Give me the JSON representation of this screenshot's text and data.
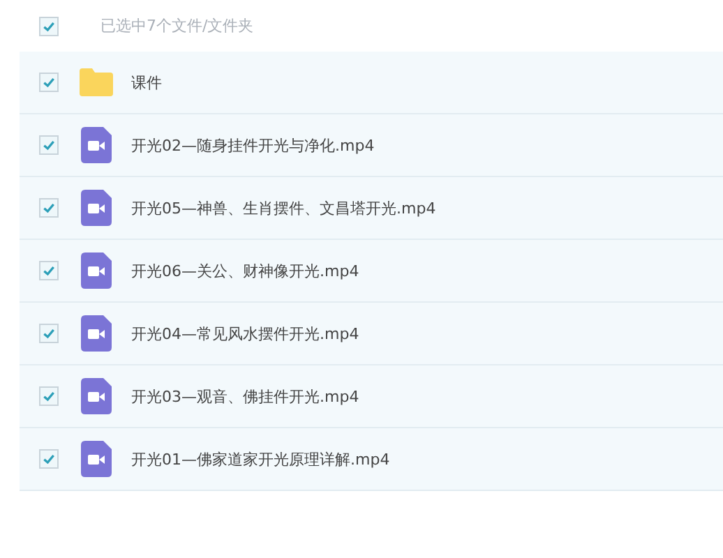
{
  "header": {
    "checked": true,
    "label": "已选中7个文件/文件夹"
  },
  "files": [
    {
      "kind": "folder",
      "name": "课件",
      "checked": true
    },
    {
      "kind": "video",
      "name": "开光02—随身挂件开光与净化.mp4",
      "checked": true
    },
    {
      "kind": "video",
      "name": "开光05—神兽、生肖摆件、文昌塔开光.mp4",
      "checked": true
    },
    {
      "kind": "video",
      "name": "开光06—关公、财神像开光.mp4",
      "checked": true
    },
    {
      "kind": "video",
      "name": "开光04—常见风水摆件开光.mp4",
      "checked": true
    },
    {
      "kind": "video",
      "name": "开光03—观音、佛挂件开光.mp4",
      "checked": true
    },
    {
      "kind": "video",
      "name": "开光01—佛家道家开光原理详解.mp4",
      "checked": true
    }
  ]
}
